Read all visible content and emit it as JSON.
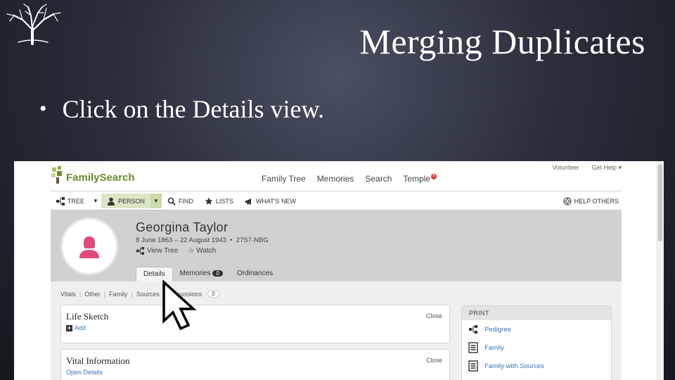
{
  "slide": {
    "title": "Merging Duplicates",
    "bullet": "Click on the Details view."
  },
  "familysearch": {
    "logo_text": "FamilySearch",
    "utility_nav": [
      "Volunteer",
      "Get Help ▾"
    ],
    "main_nav": [
      "Family Tree",
      "Memories",
      "Search",
      "Temple"
    ],
    "toolbar": {
      "tree": "TREE",
      "person": "PERSON",
      "find": "FIND",
      "lists": "LISTS",
      "whats_new": "WHAT'S NEW",
      "help_others": "HELP OTHERS"
    },
    "person": {
      "name": "Georgina Taylor",
      "dates": "8 June 1863 – 22 August 1943",
      "id": "27S7-NBG",
      "view_tree": "View Tree",
      "watch": "Watch"
    },
    "tabs": {
      "details": "Details",
      "memories": "Memories",
      "memories_count": "0",
      "ordinances": "Ordinances"
    },
    "subnav": {
      "vitals": "Vitals",
      "other": "Other",
      "family": "Family",
      "sources": "Sources",
      "discussions": "Discussions",
      "discussions_count": "0"
    },
    "cards": {
      "life_sketch": {
        "title": "Life Sketch",
        "close": "Close",
        "action": "Add"
      },
      "vital_info": {
        "title": "Vital Information",
        "close": "Close",
        "action": "Open Details"
      }
    },
    "print": {
      "header": "PRINT",
      "items": [
        "Pedigree",
        "Family",
        "Family with Sources"
      ]
    }
  },
  "colors": {
    "brand_green": "#6c8a2d",
    "link_blue": "#3a73b5",
    "avatar_pink": "#e0487e"
  }
}
